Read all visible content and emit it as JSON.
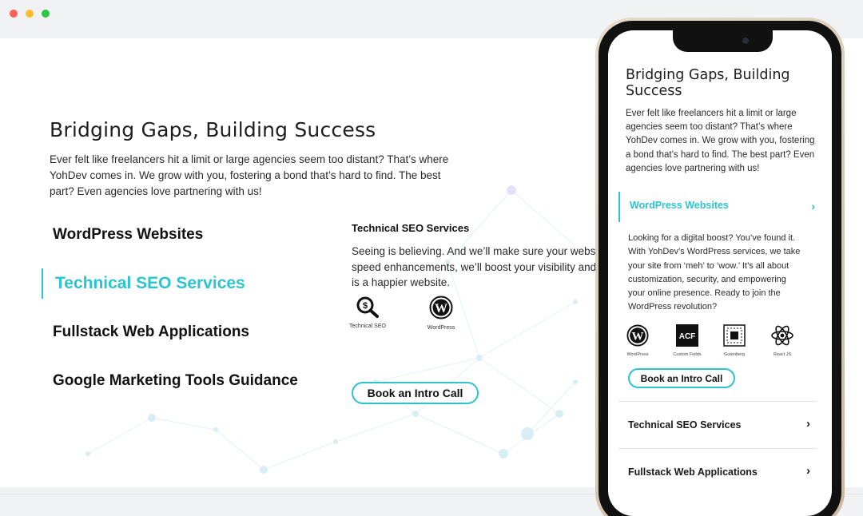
{
  "window": {
    "controls": [
      "close",
      "minimize",
      "maximize"
    ]
  },
  "desktop": {
    "title": "Bridging Gaps, Building Success",
    "intro": "Ever felt like freelancers hit a limit or large agencies seem too distant? That’s where YohDev comes in. We grow with you, fostering a bond that’s hard to find. The best part? Even agencies love partnering with us!",
    "intro_lines": [
      "Ever felt like freelancers hit a limit or large agencies seem too distant? That’s where",
      "YohDev comes in. We grow with you, fostering a bond that’s hard to find. The best",
      "part? Even agencies love partnering with us!"
    ],
    "services": [
      {
        "label": "WordPress Websites",
        "active": false
      },
      {
        "label": "Technical SEO Services",
        "active": true
      },
      {
        "label": "Fullstack Web Applications",
        "active": false
      },
      {
        "label": "Google Marketing Tools Guidance",
        "active": false
      }
    ],
    "detail": {
      "title": "Technical SEO Services",
      "text_lines": [
        "Seeing is believing. And we’ll make sure your websi",
        "speed enhancements, we’ll boost your visibility and",
        "is a happier website."
      ],
      "icons": [
        {
          "icon": "seo-magnifier-icon",
          "caption": "Technical SEO"
        },
        {
          "icon": "wordpress-icon",
          "caption": "WordPress"
        }
      ],
      "cta": "Book an Intro Call"
    }
  },
  "mobile": {
    "title_lines": [
      "Bridging Gaps, Building",
      "Success"
    ],
    "intro_lines": [
      "Ever felt like freelancers hit a limit or large",
      "agencies seem too distant? That’s where",
      "YohDev comes in. We grow with you, fostering",
      "a bond that’s hard to find. The best part? Even",
      "agencies love partnering with us!"
    ],
    "active_service": "WordPress Websites",
    "active_desc_lines": [
      "Looking for a digital boost? You’ve found it.",
      "With YohDev’s WordPress services, we take",
      "your site from ‘meh’ to ‘wow.’ It’s all about",
      "customization, security, and empowering",
      "your online presence. Ready to join the",
      "WordPress revolution?"
    ],
    "icons": [
      {
        "icon": "wordpress-icon",
        "caption": "WordPress"
      },
      {
        "icon": "acf-icon",
        "caption": "Custom Fields"
      },
      {
        "icon": "gutenberg-icon",
        "caption": "Gutenberg"
      },
      {
        "icon": "react-icon",
        "caption": "React JS"
      }
    ],
    "acf_text": "ACF",
    "cta": "Book an Intro Call",
    "collapsed_services": [
      "Technical SEO Services",
      "Fullstack Web Applications"
    ],
    "chevron": "›"
  },
  "colors": {
    "accent": "#2bc4cf",
    "text": "#1a1a1a",
    "background": "#ffffff"
  }
}
